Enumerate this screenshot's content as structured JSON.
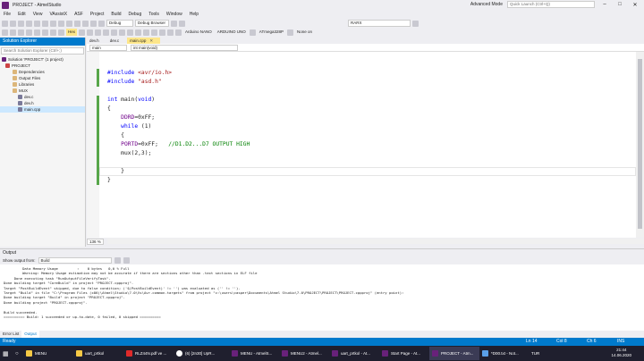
{
  "window": {
    "title": "PROJECT - AtmelStudio",
    "mode": "Advanced Mode",
    "quick_launch": "Quick Launch (Ctrl+Q)"
  },
  "menu": [
    "File",
    "Edit",
    "View",
    "VAssistX",
    "ASF",
    "Project",
    "Build",
    "Debug",
    "Tools",
    "Window",
    "Help"
  ],
  "toolbar": {
    "config": "Debug",
    "browser": "Debug Browser",
    "find": "RARX",
    "hex_label": "Hex",
    "tool1": "Arduino NANO",
    "tool2": "ARDUINO UNO",
    "device": "ATmega328P",
    "none_label": "None on"
  },
  "solution_explorer": {
    "title": "Solution Explorer",
    "search_placeholder": "Search Solution Explorer (Ctrl+;)",
    "items": [
      "Solution 'PROJECT' (1 project)",
      "PROJECT",
      "Dependencies",
      "Output Files",
      "Libraries",
      "MUX",
      "dev.c",
      "dev.h",
      "main.cpp"
    ]
  },
  "tabs": [
    "dev.h",
    "dev.c",
    "main.cpp"
  ],
  "nav": {
    "scope": "main",
    "member": "int main(void)"
  },
  "code": {
    "l1a": "#include ",
    "l1b": "<avr/io.h>",
    "l2a": "#include ",
    "l2b": "\"asd.h\"",
    "l3a": "int",
    "l3b": " main(",
    "l3c": "void",
    "l3d": ")",
    "l4": "{",
    "l5a": "DDRD",
    "l5b": "=0xFF;",
    "l6a": "while",
    "l6b": " (1)",
    "l7": "{",
    "l8a": "PORTD",
    "l8b": "=0xFF;   ",
    "l8c": "//D1.D2...D7 OUTPUT HIGH",
    "l9": "mux(2,3);",
    "l10": "}",
    "l11": "}"
  },
  "zoom": "136 %",
  "output": {
    "title": "Output",
    "show_label": "Show output from:",
    "source": "Build",
    "lines": [
      "         Data Memory Usage         :    0 bytes   0,0 % Full",
      "         Warning: Memory Usage estimation may not be accurate if there are sections other than .text sections in ELF file",
      "     Done executing task \"RunOutputFileVerifyTask\".",
      "Done building target \"CoreBuild\" in project \"PROJECT.cppproj\".",
      "Target \"PostBuildEvent\" skipped, due to false condition; ('$(PostBuildEvent)' != '') was evaluated as ('' != '').",
      "Target \"Build\" in file \"C:\\Program Files (x86)\\Atmel\\Studio\\7.0\\Vs\\Avr.common.targets\" from project \"c:\\users\\casper\\Documents\\Atmel Studio\\7.0\\PROJECT\\PROJECT\\PROJECT.cppproj\" (entry point):",
      "Done building target \"Build\" in project \"PROJECT.cppproj\".",
      "Done building project \"PROJECT.cppproj\".",
      "",
      "Build succeeded.",
      "========== Build: 1 succeeded or up-to-date, 0 failed, 0 skipped =========="
    ]
  },
  "output_tabs": [
    "Error List",
    "Output"
  ],
  "status": {
    "ready": "Ready",
    "ln": "Ln 14",
    "col": "Col 8",
    "ch": "Ch 6",
    "ins": "INS"
  },
  "taskbar": {
    "items": [
      "MENU",
      "uart_prtkol",
      "RLZ44N.pdf ve ...",
      "(6) [2n30] UpR...",
      "MENU - AtmelS...",
      "MENU2 - Atmel...",
      "uart_prtkol - At...",
      "Start Page - At...",
      "PROJECT - Atm...",
      "*D00.txt - Not..."
    ],
    "colors": [
      "#f6c945",
      "#f6c945",
      "#e02a2a",
      "#ffffff",
      "#68217a",
      "#68217a",
      "#68217a",
      "#68217a",
      "#68217a",
      "#5aa0e8"
    ],
    "lang": "TUR",
    "time": "21:44",
    "date": "14.06.2020"
  }
}
